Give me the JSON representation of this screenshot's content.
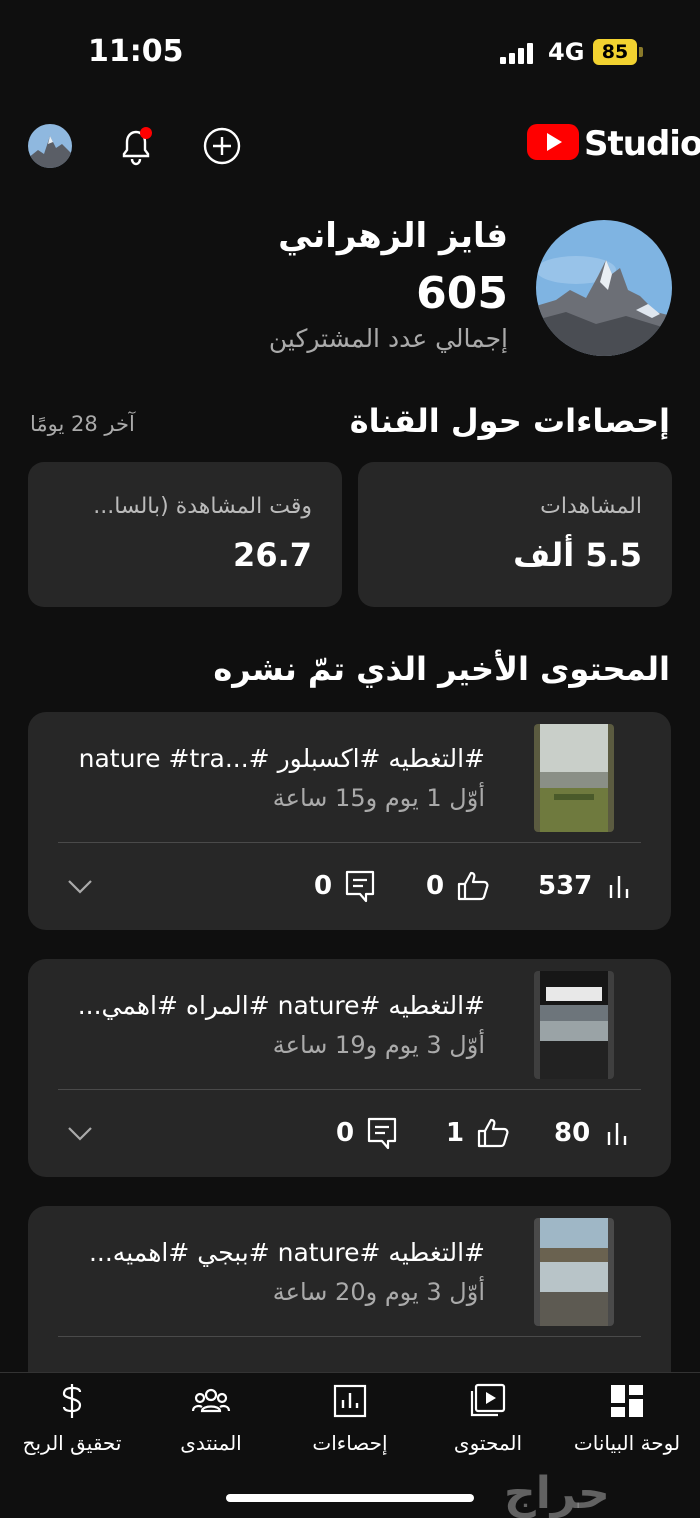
{
  "status_bar": {
    "time": "11:05",
    "network": "4G",
    "battery": "85"
  },
  "header": {
    "app_name": "Studio",
    "icons": [
      "avatar",
      "bell-icon",
      "plus-circle-icon",
      "youtube-logo"
    ]
  },
  "channel": {
    "name": "فايز الزهراني",
    "subscribers": "605",
    "subscribers_label": "إجمالي عدد المشتركين"
  },
  "stats": {
    "title": "إحصاءات حول القناة",
    "period": "آخر 28 يومًا",
    "views": {
      "label": "المشاهدات",
      "value": "5.5 ألف"
    },
    "watch_time": {
      "label": "وقت المشاهدة (بالسا...",
      "value": "26.7"
    }
  },
  "recent": {
    "title": "المحتوى الأخير الذي تمّ نشره",
    "items": [
      {
        "title": "#التغطيه #اكسبلور #...nature #tra",
        "time": "أوّل 1 يوم و15 ساعة",
        "views": "537",
        "likes": "0",
        "comments": "0"
      },
      {
        "title": "#التغطيه #nature #المراه #اهمي...",
        "time": "أوّل 3 يوم و19 ساعة",
        "views": "80",
        "likes": "1",
        "comments": "0"
      },
      {
        "title": "#التغطيه #nature #ببجي #اهميه...",
        "time": "أوّل 3 يوم و20 ساعة"
      }
    ]
  },
  "nav": {
    "dashboard": "لوحة البيانات",
    "content": "المحتوى",
    "analytics": "إحصاءات",
    "community": "المنتدى",
    "earn": "تحقيق الربح"
  },
  "watermark": "حراج",
  "colors": {
    "background": "#0f0f0f",
    "card": "#272727",
    "youtube_red": "#ff0000",
    "battery": "#f2d230",
    "notification_dot": "#ff0000"
  }
}
